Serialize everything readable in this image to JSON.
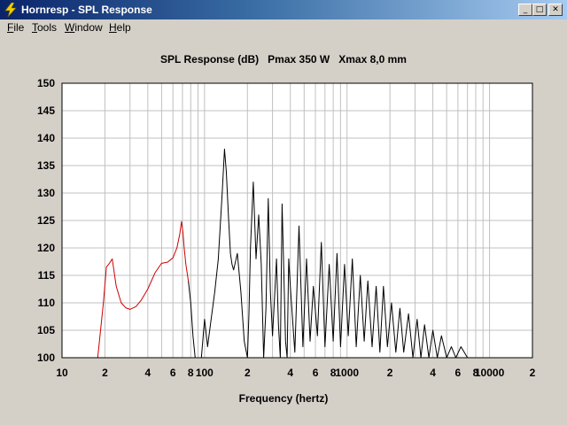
{
  "window": {
    "title": "Hornresp - SPL Response",
    "minimize_glyph": "_",
    "maximize_glyph": "□",
    "close_glyph": "✕",
    "icon": "lightning-bolt-icon"
  },
  "menu": [
    "File",
    "Tools",
    "Window",
    "Help"
  ],
  "chart_data": {
    "type": "line",
    "title": "SPL Response (dB)   Pmax 350 W   Xmax 8,0 mm",
    "xlabel": "Frequency (hertz)",
    "ylabel": "",
    "xscale": "log",
    "xlim": [
      10,
      20000
    ],
    "ylim": [
      100,
      150
    ],
    "grid": true,
    "yticks": [
      100,
      105,
      110,
      115,
      120,
      125,
      130,
      135,
      140,
      145,
      150
    ],
    "xtick_labels": [
      {
        "x": 10,
        "label": "10"
      },
      {
        "x": 20,
        "label": "2"
      },
      {
        "x": 40,
        "label": "4"
      },
      {
        "x": 60,
        "label": "6"
      },
      {
        "x": 80,
        "label": "8"
      },
      {
        "x": 100,
        "label": "100"
      },
      {
        "x": 200,
        "label": "2"
      },
      {
        "x": 400,
        "label": "4"
      },
      {
        "x": 600,
        "label": "6"
      },
      {
        "x": 800,
        "label": "8"
      },
      {
        "x": 1000,
        "label": "1000"
      },
      {
        "x": 2000,
        "label": "2"
      },
      {
        "x": 4000,
        "label": "4"
      },
      {
        "x": 6000,
        "label": "6"
      },
      {
        "x": 8000,
        "label": "8"
      },
      {
        "x": 10000,
        "label": "10000"
      },
      {
        "x": 20000,
        "label": "2"
      }
    ],
    "colors": {
      "excursion_limited": "#cc0000",
      "response": "#000000",
      "grid": "#c0c0c0",
      "plot_bg": "#ffffff"
    },
    "series": [
      {
        "color": "#cc0000",
        "x": [
          17.8,
          19.5,
          20.5,
          21.5,
          22.5,
          24,
          26,
          28,
          30,
          33,
          36,
          40,
          45,
          50,
          55,
          60,
          64,
          67,
          69,
          70.5,
          72,
          74,
          77
        ],
        "y": [
          100,
          110,
          116.5,
          117.2,
          118,
          113,
          110,
          109.1,
          108.8,
          109.3,
          110.5,
          112.5,
          115.5,
          117.2,
          117.4,
          118.2,
          120,
          122.5,
          124.8,
          123,
          120,
          117,
          114
        ]
      },
      {
        "color": "#000000",
        "x": [
          77,
          80,
          83,
          86,
          90,
          95,
          100,
          105,
          110,
          118,
          125,
          133,
          138,
          142,
          147,
          152,
          156,
          160,
          170,
          180,
          190,
          200,
          205,
          210,
          220,
          230,
          240,
          250,
          260,
          270,
          280,
          290,
          300,
          310,
          320,
          330,
          340,
          350,
          360,
          370,
          380,
          390,
          400
        ],
        "y": [
          114,
          110,
          104,
          100,
          100,
          100,
          107,
          102,
          106,
          112,
          118,
          130,
          138,
          134,
          126,
          119,
          117,
          116,
          119,
          112,
          103,
          100,
          108,
          120,
          132,
          118,
          126,
          117,
          100,
          109,
          129,
          112,
          104,
          111,
          118,
          106,
          100,
          128,
          116,
          103,
          100,
          118,
          113
        ]
      },
      {
        "color": "#000000",
        "x": [
          400,
          430,
          460,
          490,
          520,
          550,
          580,
          620,
          660,
          700,
          750,
          800,
          850,
          900,
          960,
          1020,
          1090,
          1160,
          1240,
          1320,
          1400,
          1500,
          1600,
          1700,
          1800,
          1920,
          2050,
          2200,
          2350,
          2500,
          2700,
          2900,
          3100,
          3300,
          3500,
          3750,
          4000,
          4300,
          4600,
          5000,
          5400,
          5800,
          6300,
          7000
        ],
        "y": [
          113,
          101,
          124,
          102,
          118,
          103,
          113,
          104,
          121,
          102,
          117,
          103,
          119,
          102,
          117,
          104,
          118,
          102,
          115,
          103,
          114,
          102,
          113,
          101,
          113,
          102,
          110,
          101,
          109,
          101,
          108,
          100,
          107,
          100,
          106,
          100,
          105,
          100,
          104,
          100,
          102,
          100,
          102,
          100
        ]
      }
    ]
  }
}
